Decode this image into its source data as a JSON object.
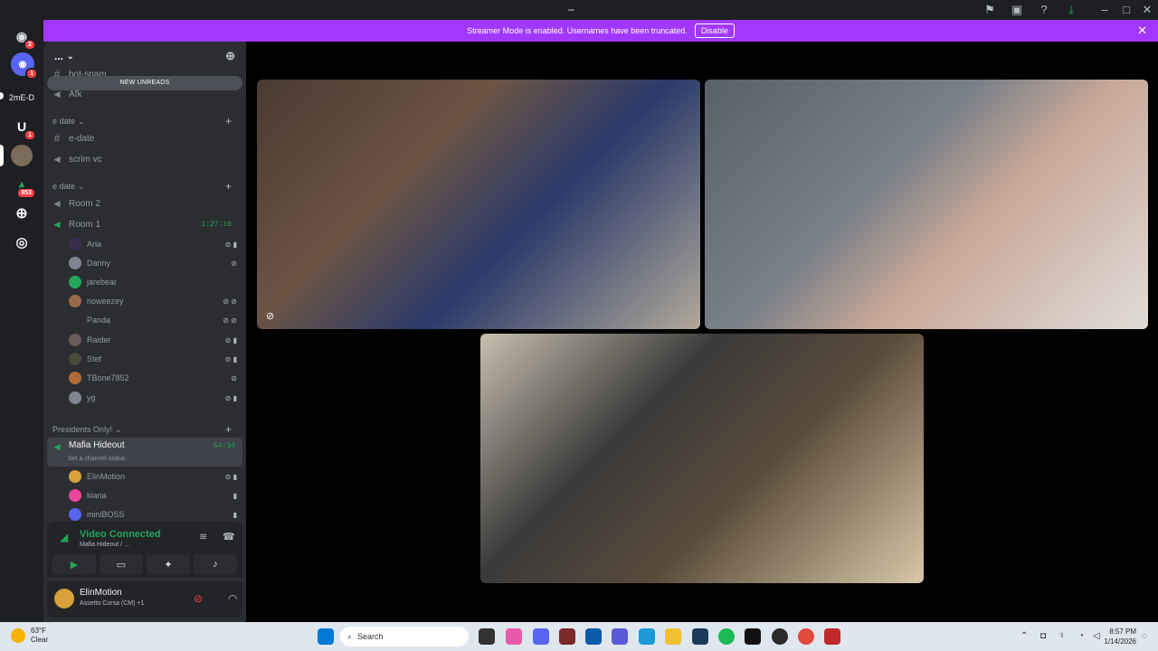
{
  "window": {
    "title": "–"
  },
  "banner": {
    "text": "Streamer Mode is enabled. Usernames have been truncated.",
    "disable_label": "Disable"
  },
  "rail": {
    "dm_badge": "2",
    "server1_badge": "1",
    "server_text": "2mE-D",
    "server3_badge": "1",
    "server5_badge": "853"
  },
  "sidebar": {
    "server_name": "...",
    "new_unreads": "NEW UNREADS",
    "bot_spam": "bot-spam",
    "afk": "Afk",
    "cat1": "e date",
    "edate_channel": "e-date",
    "scrim_vc": "scrim vc",
    "cat2": "e date",
    "room2": "Room 2",
    "room1": "Room 1",
    "room1_time": "1:27:16",
    "room1_members": [
      "Aria",
      "Danny",
      "jarebear",
      "noweezey",
      "Panda",
      "Raider",
      "Stef",
      "TBone7852",
      "yg"
    ],
    "cat3": "Presidents Only!",
    "mafia": "Mafia Hideout",
    "mafia_time": "54:34",
    "mafia_status": "Set a channel status",
    "mafia_members": [
      "ElinMotion",
      "kiana",
      "miniBOSS"
    ]
  },
  "voice": {
    "status": "Video Connected",
    "location": "Mafia Hideout / ..."
  },
  "user": {
    "name": "ElinMotion",
    "activity": "Assetto Corsa (CM) +1"
  },
  "taskbar": {
    "temp": "63°F",
    "condition": "Clear",
    "search": "Search",
    "time": "8:57 PM",
    "date": "1/14/2026"
  },
  "colors": {
    "accent": "#a238ff",
    "voice_green": "#23a55a",
    "sidebar": "#2b2d31",
    "rail": "#1e1f22"
  }
}
